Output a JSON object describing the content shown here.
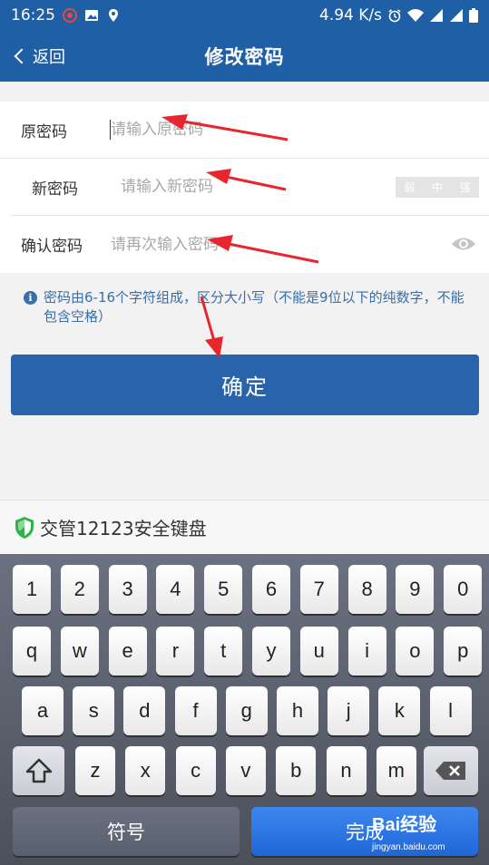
{
  "status_bar": {
    "time": "16:25",
    "net_speed": "4.94 K/s"
  },
  "nav": {
    "back_label": "返回",
    "title": "修改密码"
  },
  "form": {
    "old_password": {
      "label": "原密码",
      "placeholder": "请输入原密码"
    },
    "new_password": {
      "label": "新密码",
      "placeholder": "请输入新密码",
      "strength": [
        "弱",
        "中",
        "强"
      ]
    },
    "confirm_password": {
      "label": "确认密码",
      "placeholder": "请再次输入密码"
    }
  },
  "hint": "密码由6-16个字符组成，区分大小写（不能是9位以下的纯数字，不能包含空格）",
  "confirm_button": "确定",
  "keyboard": {
    "title": "交管12123安全键盘",
    "row1": [
      "1",
      "2",
      "3",
      "4",
      "5",
      "6",
      "7",
      "8",
      "9",
      "0"
    ],
    "row2": [
      "q",
      "w",
      "e",
      "r",
      "t",
      "y",
      "u",
      "i",
      "o",
      "p"
    ],
    "row3": [
      "a",
      "s",
      "d",
      "f",
      "g",
      "h",
      "j",
      "k",
      "l"
    ],
    "row4": [
      "z",
      "x",
      "c",
      "v",
      "b",
      "n",
      "m"
    ],
    "symbol_label": "符号",
    "done_label": "完成"
  },
  "watermark": {
    "logo": "Bai经验",
    "url": "jingyan.baidu.com"
  },
  "colors": {
    "brand": "#1f5fa6",
    "button": "#2863ac",
    "hint": "#3a6ea8",
    "annotation_arrow": "#e8262d"
  }
}
